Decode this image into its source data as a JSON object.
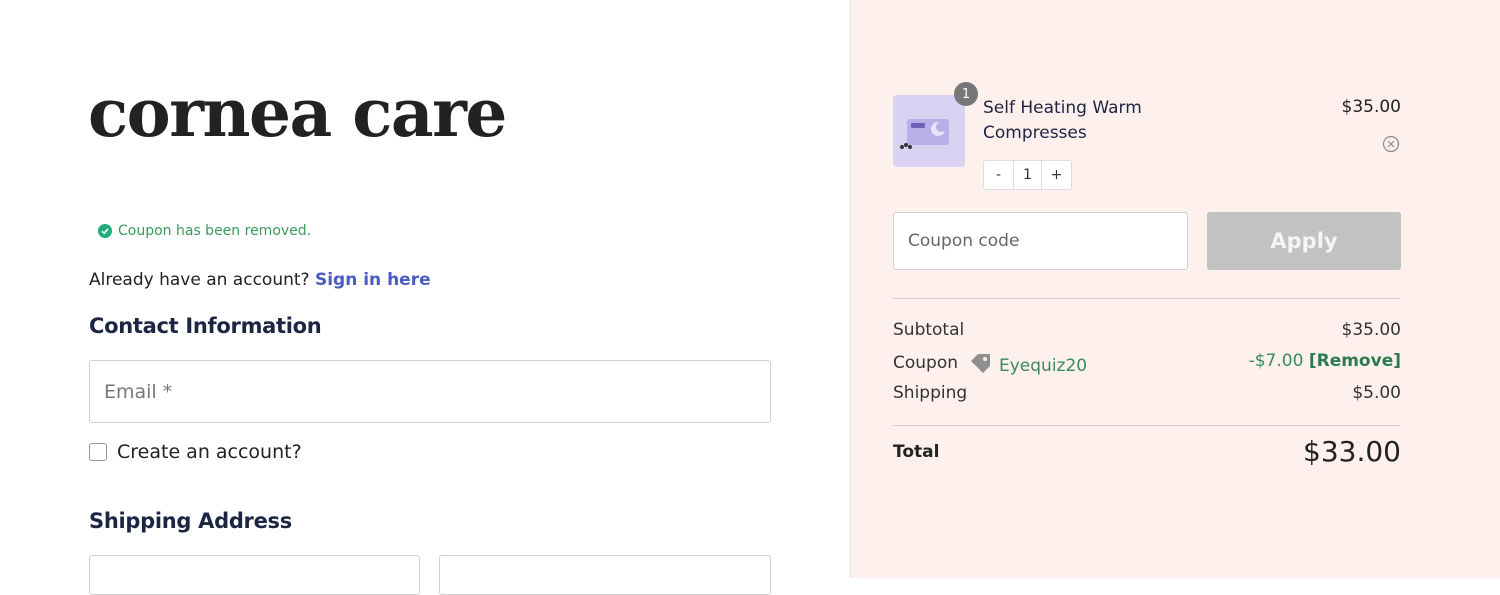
{
  "brand": {
    "logo_text": "cornea care"
  },
  "notice": {
    "text": "Coupon has been removed."
  },
  "account": {
    "prompt": "Already have an account?",
    "sign_in_link": "Sign in here"
  },
  "contact": {
    "title": "Contact Information",
    "email_placeholder": "Email *",
    "create_account_label": "Create an account?"
  },
  "shipping": {
    "title": "Shipping Address"
  },
  "cart": {
    "item": {
      "quantity_badge": "1",
      "name": "Self Heating Warm Compresses",
      "price": "$35.00",
      "qty_minus": "-",
      "qty_value": "1",
      "qty_plus": "+"
    },
    "coupon_placeholder": "Coupon code",
    "apply_label": "Apply",
    "subtotal_label": "Subtotal",
    "subtotal_value": "$35.00",
    "coupon_label": "Coupon",
    "coupon_code": "Eyequiz20",
    "coupon_discount": "-$7.00",
    "coupon_remove": "[Remove]",
    "shipping_label": "Shipping",
    "shipping_value": "$5.00",
    "total_label": "Total",
    "total_value": "$33.00"
  },
  "colors": {
    "sidebar_bg": "#fdf0ed",
    "link": "#4a5bc4",
    "success": "#3a9a5c",
    "apply_disabled": "#c2c2c2"
  }
}
